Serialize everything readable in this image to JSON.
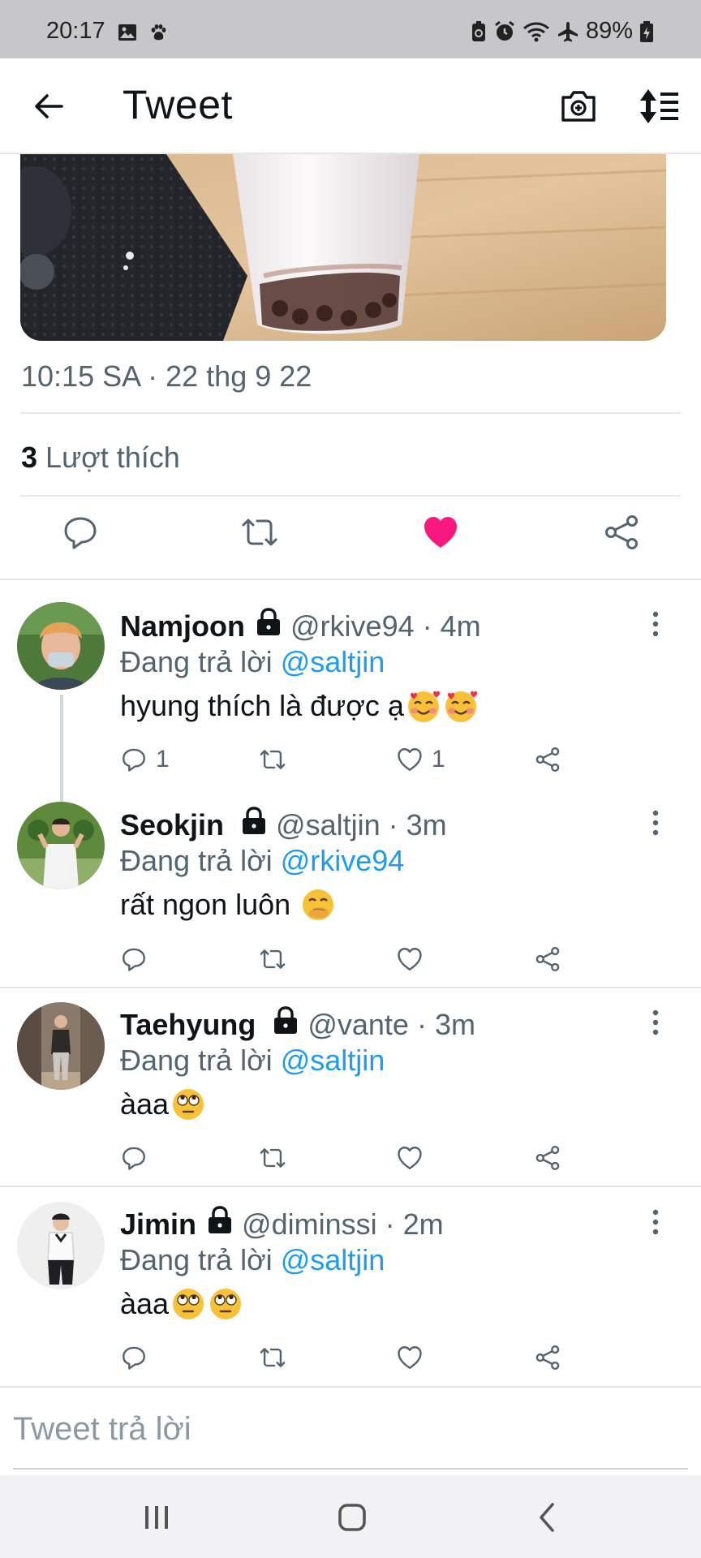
{
  "status_bar": {
    "time": "20:17",
    "battery": "89%",
    "left_icons": [
      "gallery-icon",
      "paw-icon"
    ],
    "right_icons": [
      "battery-saver-icon",
      "alarm-icon",
      "wifi-icon",
      "airplane-icon",
      "charging-battery-icon"
    ]
  },
  "header": {
    "title": "Tweet",
    "back_icon": "back-arrow-icon",
    "camera_icon": "camera-icon",
    "sort_icon": "sort-icon"
  },
  "tweet": {
    "timestamp": "10:15 SA · 22 thg 9 22",
    "likes_count": "3",
    "likes_label": "Lượt thích",
    "actions": [
      "reply-icon",
      "retweet-icon",
      "liked-heart-icon",
      "share-icon"
    ],
    "liked": true
  },
  "replies": [
    {
      "name": "Namjoon",
      "handle": "@rkive94 · 4m",
      "reply_prefix": "Đang trả lời ",
      "reply_to": "@saltjin",
      "text": "hyung thích là được ạ",
      "emojis": [
        "smiling-face-with-hearts",
        "smiling-face-with-hearts"
      ],
      "reply_count": "1",
      "like_count": "1"
    },
    {
      "name": "Seokjin",
      "handle": "@saltjin · 3m",
      "reply_prefix": "Đang trả lời ",
      "reply_to": "@rkive94",
      "text": "rất ngon luôn ",
      "emojis": [
        "face-with-hand-over-mouth"
      ],
      "reply_count": "",
      "like_count": ""
    },
    {
      "name": "Taehyung",
      "handle": "@vante · 3m",
      "reply_prefix": "Đang trả lời ",
      "reply_to": "@saltjin",
      "text": "àaa",
      "emojis": [
        "face-with-rolling-eyes"
      ],
      "reply_count": "",
      "like_count": ""
    },
    {
      "name": "Jimin",
      "handle": "@diminssi · 2m",
      "reply_prefix": "Đang trả lời ",
      "reply_to": "@saltjin",
      "text": "àaa",
      "emojis": [
        "face-with-rolling-eyes",
        "face-with-rolling-eyes"
      ],
      "reply_count": "",
      "like_count": ""
    }
  ],
  "compose": {
    "placeholder": "Tweet trả lời"
  },
  "colors": {
    "accent": "#1d9bf0",
    "like": "#f91880",
    "secondary_text": "#536471"
  },
  "nav_bar": {
    "icons": [
      "recent-apps-icon",
      "home-icon",
      "nav-back-icon"
    ]
  }
}
